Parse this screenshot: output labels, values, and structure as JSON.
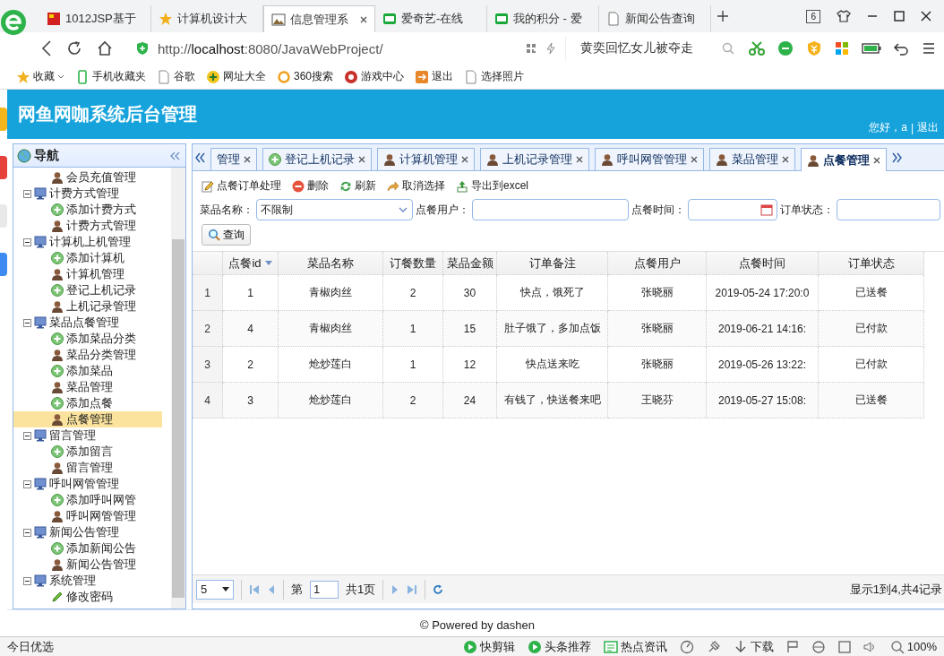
{
  "browser": {
    "tabs": [
      {
        "title": "1012JSP基于",
        "kind": "flag",
        "selected": false
      },
      {
        "title": "计算机设计大",
        "kind": "star",
        "selected": false
      },
      {
        "title": "信息管理系",
        "kind": "picture",
        "selected": true
      },
      {
        "title": "爱奇艺-在线",
        "kind": "tv",
        "selected": false
      },
      {
        "title": "我的积分 - 爱",
        "kind": "tv",
        "selected": false
      },
      {
        "title": "新闻公告查询",
        "kind": "page",
        "selected": false
      }
    ],
    "tab_count": "6",
    "url": "http://**localhost**:8080/JavaWebProject/",
    "search": "黄奕回忆女儿被夺走",
    "bookmarks": [
      {
        "label": "收藏",
        "kind": "star"
      },
      {
        "label": "手机收藏夹",
        "kind": "phone"
      },
      {
        "label": "谷歌",
        "kind": "page"
      },
      {
        "label": "网址大全",
        "kind": "plus"
      },
      {
        "label": "360搜索",
        "kind": "ring"
      },
      {
        "label": "游戏中心",
        "kind": "game"
      },
      {
        "label": "退出",
        "kind": "exit"
      },
      {
        "label": "选择照片",
        "kind": "page"
      }
    ]
  },
  "header": {
    "title": "网鱼网咖系统后台管理",
    "greeting": "您好，a",
    "separator": "|",
    "logout": "退出"
  },
  "nav": {
    "title": "导航",
    "tree": [
      {
        "children": [
          {
            "label": "会员充值管理",
            "kind": "manage",
            "selected": false
          }
        ]
      },
      {
        "label": "计费方式管理",
        "expanded": true,
        "selected": false,
        "children": [
          {
            "label": "添加计费方式",
            "kind": "add",
            "selected": false
          },
          {
            "label": "计费方式管理",
            "kind": "manage",
            "selected": false
          }
        ]
      },
      {
        "label": "计算机上机管理",
        "expanded": true,
        "selected": false,
        "children": [
          {
            "label": "添加计算机",
            "kind": "add",
            "selected": false
          },
          {
            "label": "计算机管理",
            "kind": "manage",
            "selected": false
          },
          {
            "label": "登记上机记录",
            "kind": "add",
            "selected": false
          },
          {
            "label": "上机记录管理",
            "kind": "manage",
            "selected": false
          }
        ]
      },
      {
        "label": "菜品点餐管理",
        "expanded": true,
        "selected": false,
        "children": [
          {
            "label": "添加菜品分类",
            "kind": "add",
            "selected": false
          },
          {
            "label": "菜品分类管理",
            "kind": "manage",
            "selected": false
          },
          {
            "label": "添加菜品",
            "kind": "add",
            "selected": false
          },
          {
            "label": "菜品管理",
            "kind": "manage",
            "selected": false
          },
          {
            "label": "添加点餐",
            "kind": "add",
            "selected": false
          },
          {
            "label": "点餐管理",
            "kind": "manage",
            "selected": true
          }
        ]
      },
      {
        "label": "留言管理",
        "expanded": true,
        "selected": false,
        "children": [
          {
            "label": "添加留言",
            "kind": "add",
            "selected": false
          },
          {
            "label": "留言管理",
            "kind": "manage",
            "selected": false
          }
        ]
      },
      {
        "label": "呼叫网管管理",
        "expanded": true,
        "selected": false,
        "children": [
          {
            "label": "添加呼叫网管",
            "kind": "add",
            "selected": false
          },
          {
            "label": "呼叫网管管理",
            "kind": "manage",
            "selected": false
          }
        ]
      },
      {
        "label": "新闻公告管理",
        "expanded": true,
        "selected": false,
        "children": [
          {
            "label": "添加新闻公告",
            "kind": "add",
            "selected": false
          },
          {
            "label": "新闻公告管理",
            "kind": "manage",
            "selected": false
          }
        ]
      },
      {
        "label": "系统管理",
        "expanded": true,
        "selected": false,
        "children": [
          {
            "label": "修改密码",
            "kind": "edit",
            "selected": false
          }
        ]
      }
    ]
  },
  "tabs": [
    {
      "label": "管理",
      "kind": "none",
      "selected": false
    },
    {
      "label": "登记上机记录",
      "kind": "add",
      "selected": false
    },
    {
      "label": "计算机管理",
      "kind": "manage",
      "selected": false
    },
    {
      "label": "上机记录管理",
      "kind": "manage",
      "selected": false
    },
    {
      "label": "呼叫网管管理",
      "kind": "manage",
      "selected": false
    },
    {
      "label": "菜品管理",
      "kind": "manage",
      "selected": false
    },
    {
      "label": "点餐管理",
      "kind": "manage",
      "selected": true
    }
  ],
  "toolbar": [
    {
      "label": "点餐订单处理",
      "kind": "edit"
    },
    {
      "label": "删除",
      "kind": "delete"
    },
    {
      "label": "刷新",
      "kind": "refresh"
    },
    {
      "label": "取消选择",
      "kind": "undo"
    },
    {
      "label": "导出到excel",
      "kind": "export"
    }
  ],
  "filters": [
    {
      "label": "菜品名称：",
      "kind": "select",
      "value": "不限制"
    },
    {
      "label": "点餐用户：",
      "kind": "text"
    },
    {
      "label": "点餐时间：",
      "kind": "date"
    },
    {
      "label": "订单状态：",
      "kind": "text"
    }
  ],
  "query_button": "查询",
  "table": {
    "columns": [
      {
        "label": "点餐id",
        "sorted_descending": true
      },
      {
        "label": "菜品名称"
      },
      {
        "label": "订餐数量"
      },
      {
        "label": "菜品金额"
      },
      {
        "label": "订单备注"
      },
      {
        "label": "点餐用户"
      },
      {
        "label": "点餐时间"
      },
      {
        "label": "订单状态"
      }
    ],
    "rows": [
      {
        "number": "1",
        "cells": [
          "1",
          "青椒肉丝",
          "2",
          "30",
          "快点，饿死了",
          "张晓丽",
          "2019-05-24 17:20:0",
          "已送餐"
        ]
      },
      {
        "number": "2",
        "cells": [
          "4",
          "青椒肉丝",
          "1",
          "15",
          "肚子饿了，多加点饭",
          "张晓丽",
          "2019-06-21 14:16:",
          "已付款"
        ]
      },
      {
        "number": "3",
        "cells": [
          "2",
          "炝炒莲白",
          "1",
          "12",
          "快点送来吃",
          "张晓丽",
          "2019-05-26 13:22:",
          "已付款"
        ]
      },
      {
        "number": "4",
        "cells": [
          "3",
          "炝炒莲白",
          "2",
          "24",
          "有钱了，快送餐来吧",
          "王晓芬",
          "2019-05-27 15:08:",
          "已送餐"
        ]
      }
    ]
  },
  "pager": {
    "page_size": "5",
    "page_prefix": "第",
    "page": "1",
    "page_total": "共1页",
    "summary": "显示1到4,共4记录"
  },
  "footer": "© Powered by dashen",
  "status_bar": {
    "left": "今日优选",
    "items": [
      {
        "label": "快剪辑",
        "kind": "play"
      },
      {
        "label": "头条推荐",
        "kind": "play"
      },
      {
        "label": "热点资讯",
        "kind": "news"
      },
      {
        "label": "下载",
        "kind": "download"
      },
      {
        "label": "100%",
        "kind": "zoom"
      }
    ]
  }
}
